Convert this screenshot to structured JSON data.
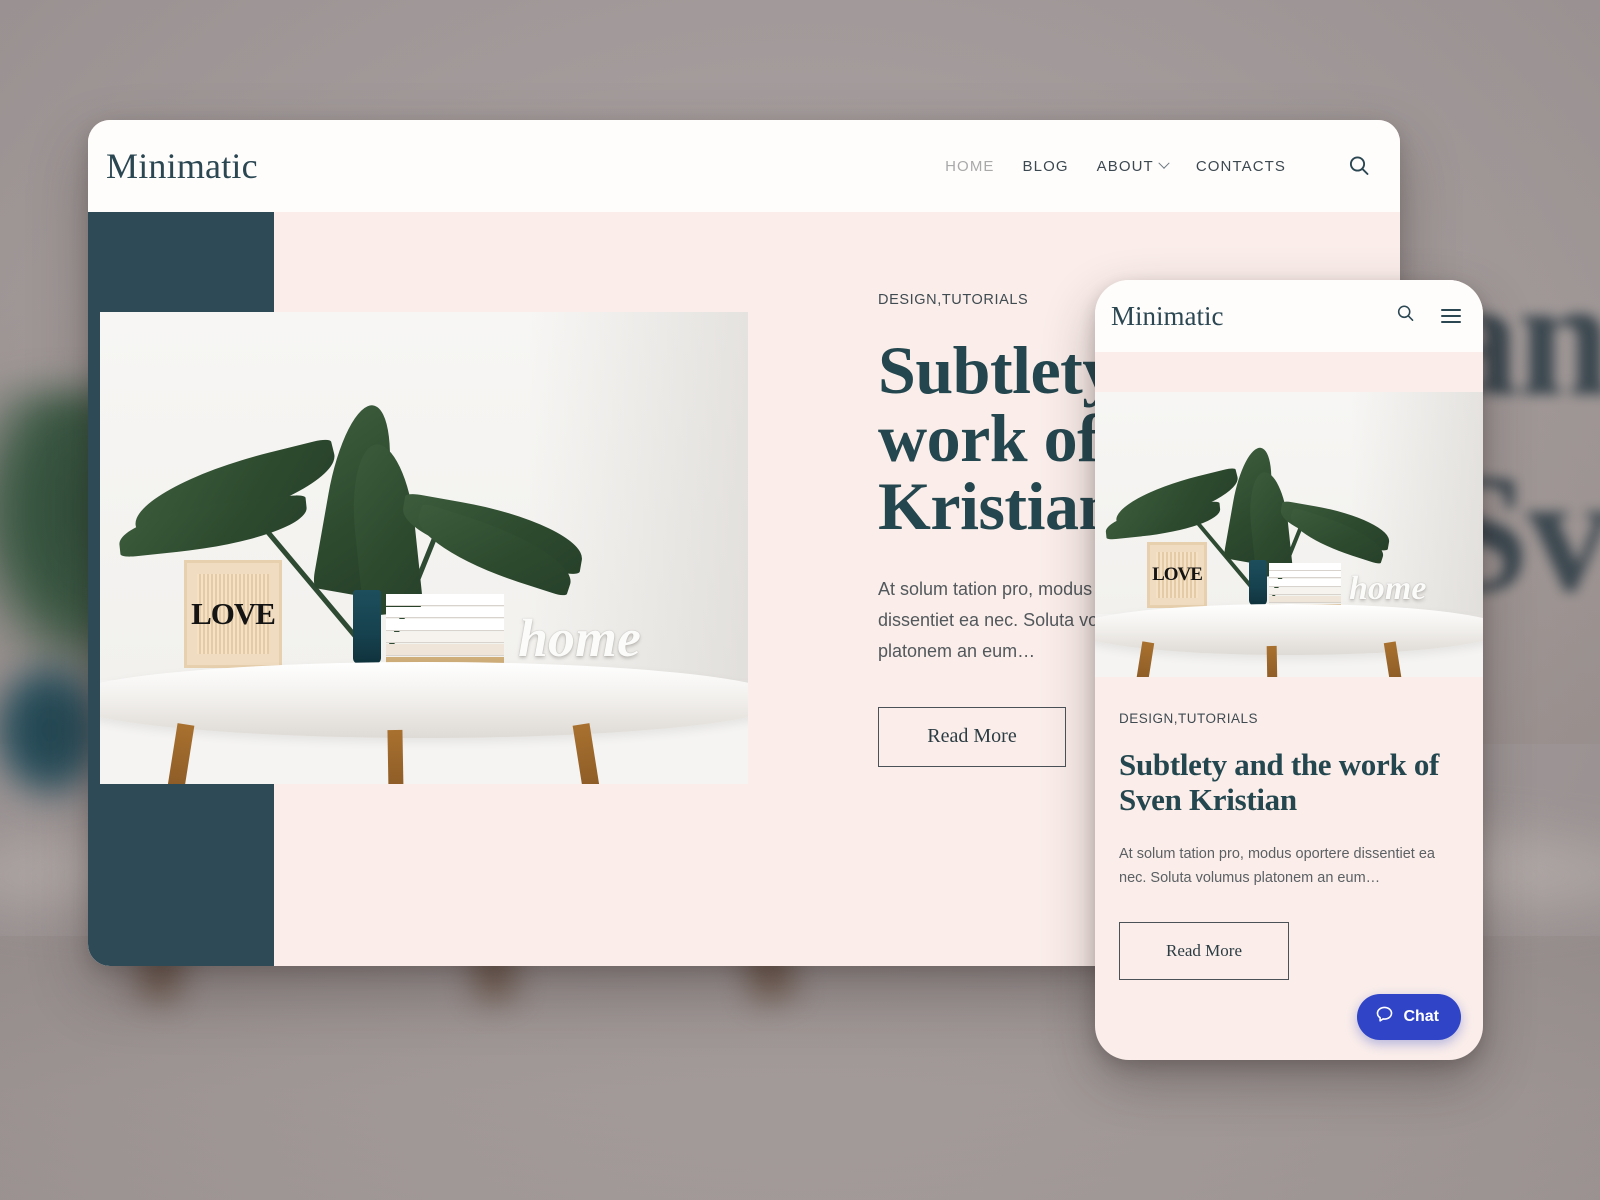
{
  "site": {
    "brand": "Minimatic"
  },
  "desktop": {
    "nav": [
      {
        "label": "HOME",
        "muted": true,
        "caret": false
      },
      {
        "label": "BLOG",
        "muted": false,
        "caret": false
      },
      {
        "label": "ABOUT",
        "muted": false,
        "caret": true
      },
      {
        "label": "CONTACTS",
        "muted": false,
        "caret": false
      }
    ],
    "search_icon": "search-icon",
    "article": {
      "kicker": "DESIGN,TUTORIALS",
      "title": "Subtlety and the work of Sven Kristian",
      "excerpt": "At solum tation pro, modus oportere dissentiet ea nec. Soluta volumus platonem an eum…",
      "read_more": "Read More"
    }
  },
  "mobile": {
    "search_icon": "search-icon",
    "menu_icon": "hamburger-icon",
    "article": {
      "kicker": "DESIGN,TUTORIALS",
      "title": "Subtlety and the work of Sven Kristian",
      "excerpt": "At solum tation pro, modus oportere dissentiet ea nec. Soluta volumus platonem an eum…",
      "read_more": "Read More"
    },
    "chat": {
      "label": "Chat",
      "icon": "chat-bubble-icon",
      "color": "#2f44c7"
    }
  },
  "photo": {
    "frame_art": "LOVE",
    "sign_word": "home"
  },
  "backdrop": {
    "headline_fragment_1": "an",
    "headline_fragment_2": "Sv"
  },
  "colors": {
    "teal_block": "#2e4a56",
    "blush_bg": "#fbeeea",
    "heading": "#24474f",
    "chat_blue": "#2f44c7"
  }
}
